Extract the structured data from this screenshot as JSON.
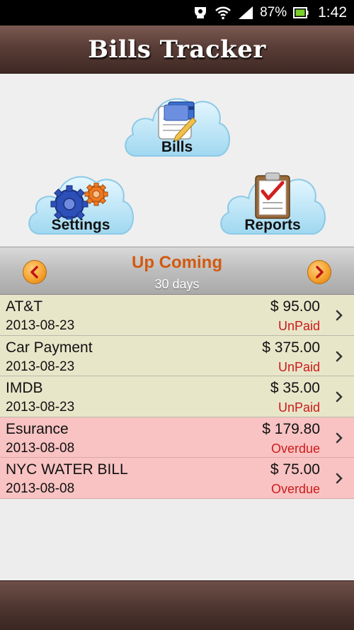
{
  "status_bar": {
    "battery": "87%",
    "time": "1:42",
    "icons": [
      "notification-icon",
      "wifi-icon",
      "signal-icon",
      "battery-icon"
    ]
  },
  "app": {
    "title": "Bills Tracker"
  },
  "menu": {
    "bills_label": "Bills",
    "settings_label": "Settings",
    "reports_label": "Reports"
  },
  "upcoming": {
    "title": "Up Coming",
    "range": "30 days"
  },
  "bills": [
    {
      "name": "AT&T",
      "date": "2013-08-23",
      "amount": "$ 95.00",
      "status": "UnPaid",
      "kind": "unpaid"
    },
    {
      "name": "Car Payment",
      "date": "2013-08-23",
      "amount": "$ 375.00",
      "status": "UnPaid",
      "kind": "unpaid"
    },
    {
      "name": "IMDB",
      "date": "2013-08-23",
      "amount": "$ 35.00",
      "status": "UnPaid",
      "kind": "unpaid"
    },
    {
      "name": "Esurance",
      "date": "2013-08-08",
      "amount": "$ 179.80",
      "status": "Overdue",
      "kind": "overdue"
    },
    {
      "name": "NYC WATER BILL",
      "date": "2013-08-08",
      "amount": "$ 75.00",
      "status": "Overdue",
      "kind": "overdue"
    }
  ],
  "colors": {
    "title_bar": "#5a3d37",
    "upcoming_title": "#d25a10",
    "unpaid_row": "#e8e6c9",
    "overdue_row": "#f9c3c3",
    "status_text": "#cc1a1a",
    "cloud": "#bfe6f7"
  }
}
